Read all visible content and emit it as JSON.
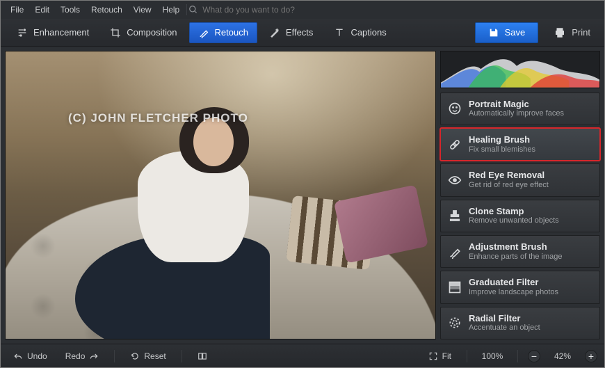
{
  "menu": {
    "items": [
      "File",
      "Edit",
      "Tools",
      "Retouch",
      "View",
      "Help"
    ],
    "search_placeholder": "What do you want to do?"
  },
  "tabs": {
    "enhancement": "Enhancement",
    "composition": "Composition",
    "retouch": "Retouch",
    "effects": "Effects",
    "captions": "Captions",
    "active": "retouch"
  },
  "actions": {
    "save": "Save",
    "print": "Print"
  },
  "canvas": {
    "watermark": "(C) JOHN FLETCHER PHOTO"
  },
  "tools": [
    {
      "id": "portrait-magic",
      "title": "Portrait Magic",
      "desc": "Automatically improve faces",
      "icon": "face-icon"
    },
    {
      "id": "healing-brush",
      "title": "Healing Brush",
      "desc": "Fix small blemishes",
      "icon": "bandage-icon",
      "selected": true
    },
    {
      "id": "red-eye",
      "title": "Red Eye Removal",
      "desc": "Get rid of red eye effect",
      "icon": "eye-icon"
    },
    {
      "id": "clone-stamp",
      "title": "Clone Stamp",
      "desc": "Remove unwanted objects",
      "icon": "stamp-icon"
    },
    {
      "id": "adjustment-brush",
      "title": "Adjustment Brush",
      "desc": "Enhance parts of the image",
      "icon": "brush-icon"
    },
    {
      "id": "graduated-filter",
      "title": "Graduated Filter",
      "desc": "Improve landscape photos",
      "icon": "gradient-icon"
    },
    {
      "id": "radial-filter",
      "title": "Radial Filter",
      "desc": "Accentuate an object",
      "icon": "radial-icon"
    }
  ],
  "bottom": {
    "undo": "Undo",
    "redo": "Redo",
    "reset": "Reset",
    "fit": "Fit",
    "zoom_fill": "100%",
    "zoom_current": "42%"
  }
}
